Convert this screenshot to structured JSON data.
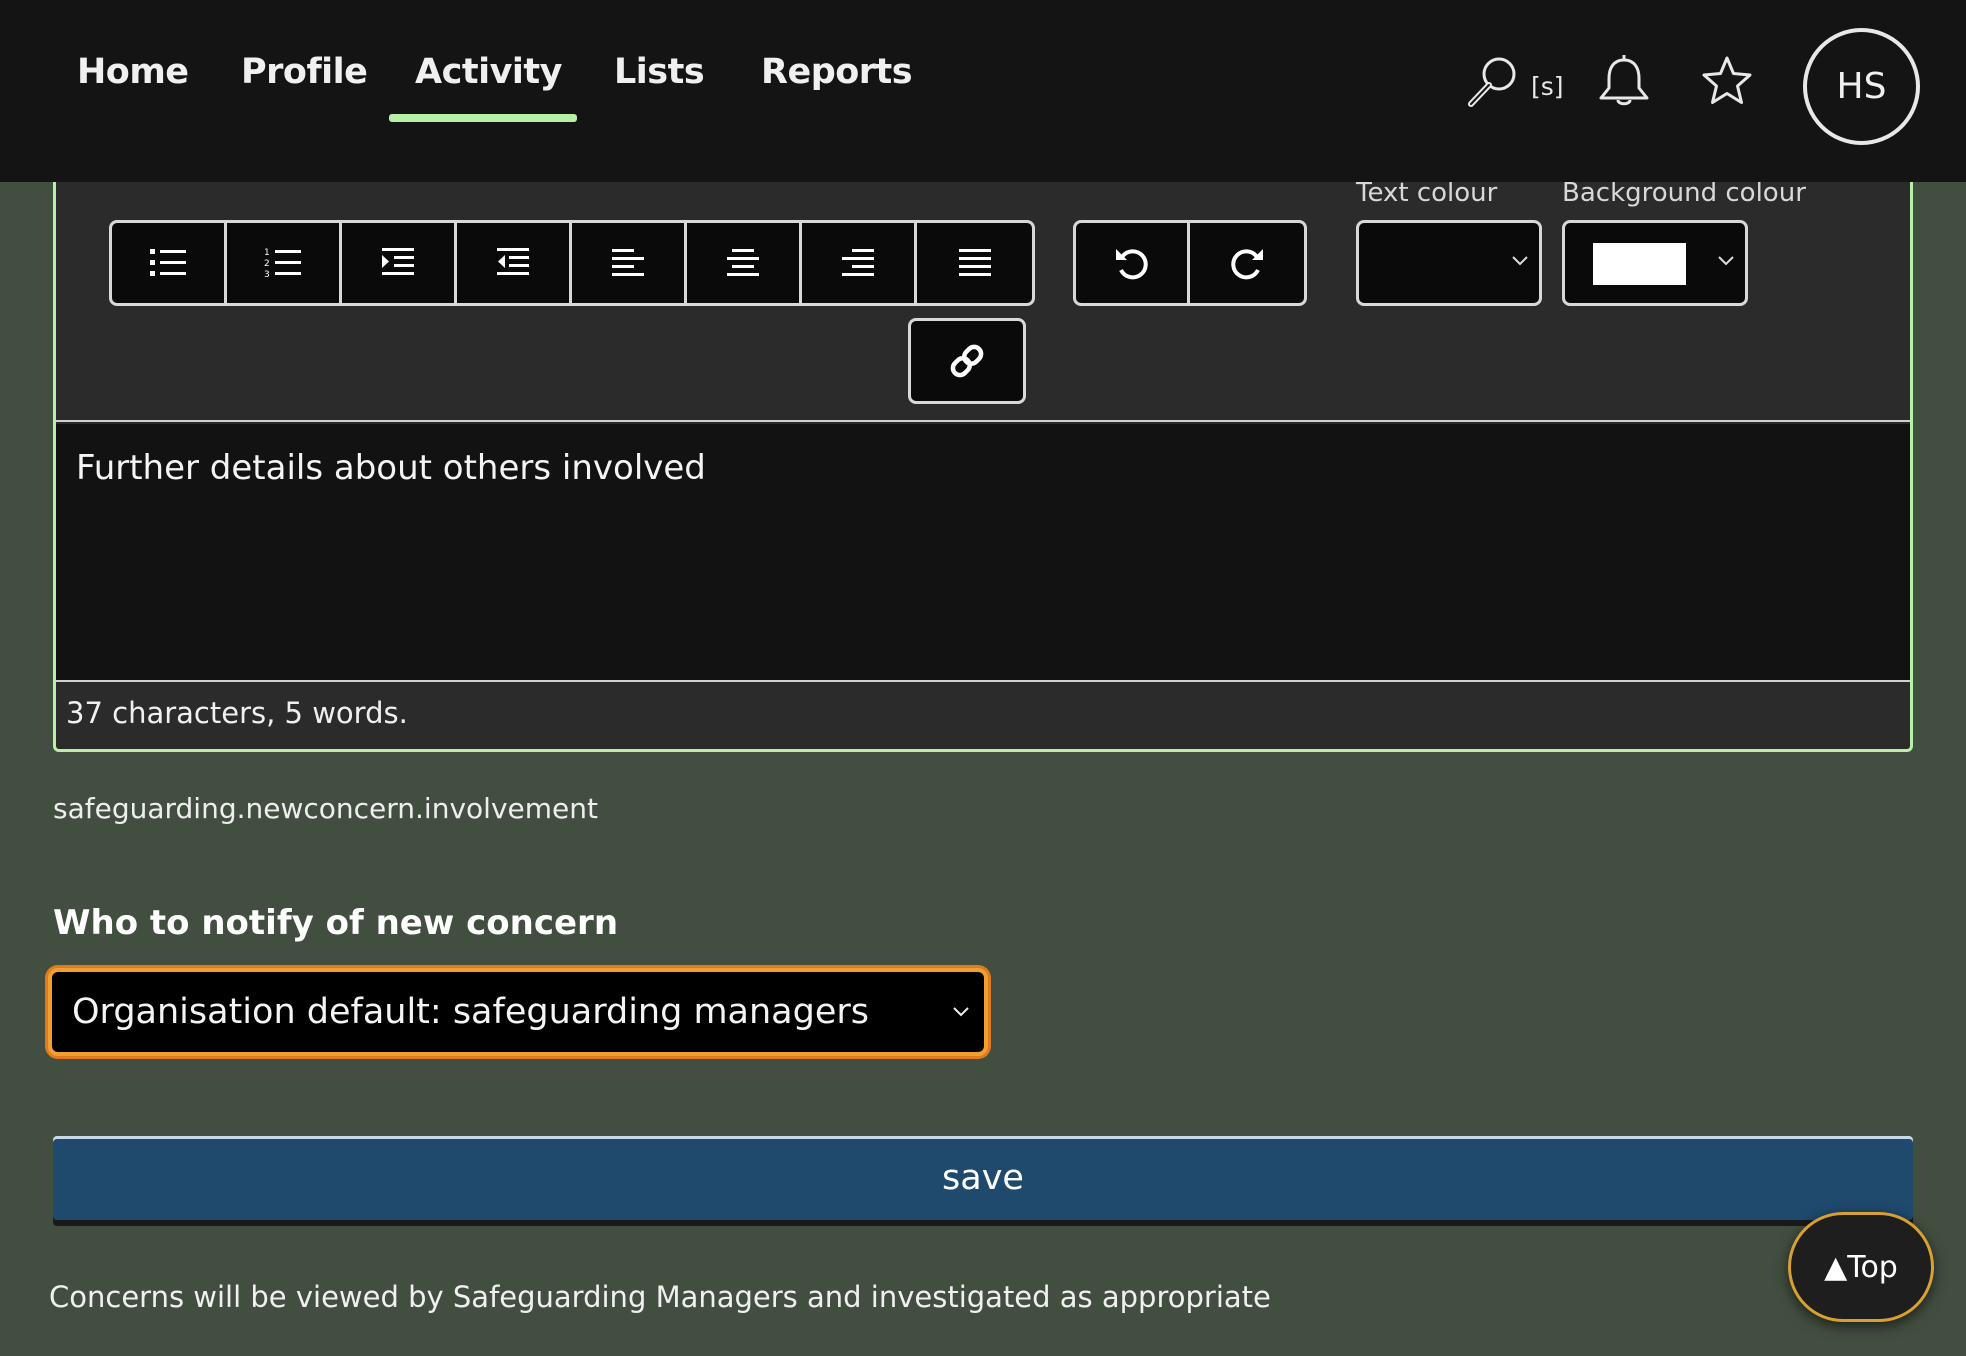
{
  "nav": {
    "items": [
      {
        "label": "Home"
      },
      {
        "label": "Profile"
      },
      {
        "label": "Activity",
        "active": true
      },
      {
        "label": "Lists"
      },
      {
        "label": "Reports"
      }
    ],
    "search_shortcut": "[s]",
    "avatar_initials": "HS",
    "active_color": "#b8f0a8"
  },
  "editor": {
    "text_colour_label": "Text colour",
    "background_colour_label": "Background colour",
    "background_colour_value": "#ffffff",
    "content": "Further details about others involved",
    "counter": "37 characters, 5 words."
  },
  "form": {
    "field_key": "safeguarding.newconcern.involvement",
    "notify_title": "Who to notify of new concern",
    "notify_selected": "Organisation default: safeguarding managers",
    "save_label": "save",
    "footnote": "Concerns will be viewed by Safeguarding Managers and investigated as appropriate"
  },
  "top_button": "▲Top",
  "colors": {
    "page_bg": "#424f40",
    "topbar_bg": "#141414",
    "save_bg": "#1f4a6e",
    "focus_ring": "#f0a030"
  }
}
